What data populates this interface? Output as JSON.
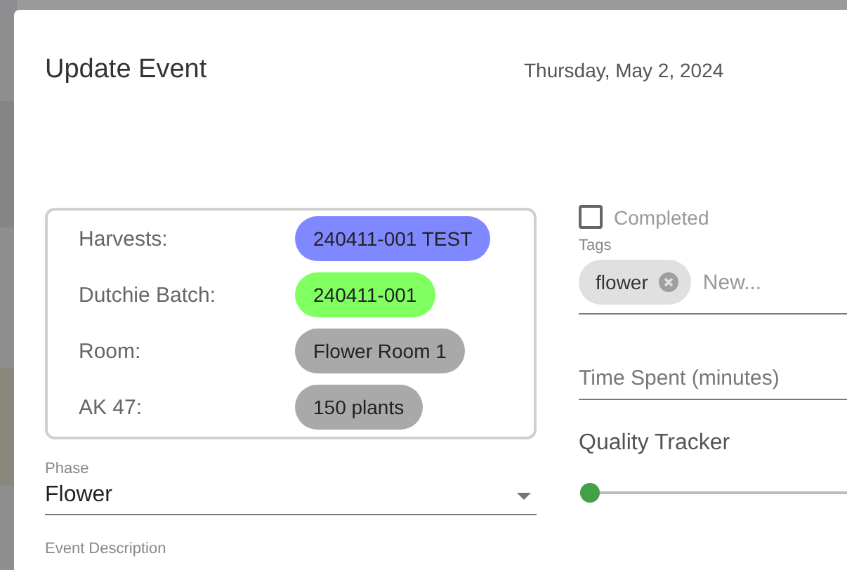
{
  "dialog": {
    "title": "Update Event",
    "date": "Thursday, May 2, 2024"
  },
  "info": [
    {
      "label": "Harvests:",
      "value": "240411-001 TEST",
      "color": "#8088ff"
    },
    {
      "label": "Dutchie Batch:",
      "value": "240411-001",
      "color": "#80ff60"
    },
    {
      "label": "Room:",
      "value": "Flower Room 1",
      "color": "#a9a9a9"
    },
    {
      "label": "AK 47:",
      "value": "150 plants",
      "color": "#a9a9a9"
    }
  ],
  "phase": {
    "label": "Phase",
    "value": "Flower"
  },
  "event_description": {
    "label": "Event Description"
  },
  "completed": {
    "label": "Completed",
    "checked": false
  },
  "tags": {
    "label": "Tags",
    "items": [
      "flower"
    ],
    "placeholder": "New..."
  },
  "time_spent": {
    "placeholder": "Time Spent (minutes)"
  },
  "quality_tracker": {
    "label": "Quality Tracker",
    "level": 0
  }
}
